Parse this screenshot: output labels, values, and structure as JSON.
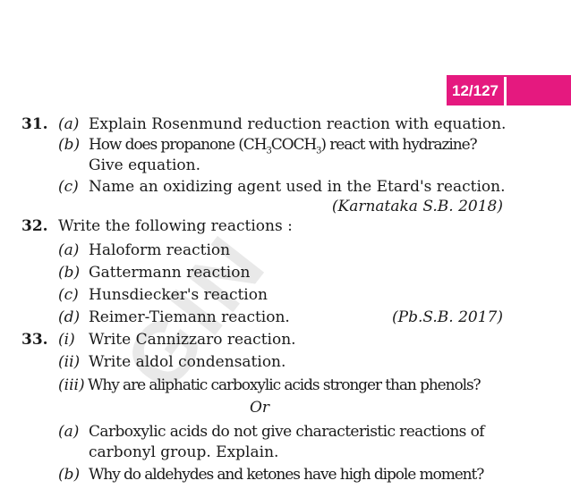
{
  "header": {
    "page_number": "12/127"
  },
  "watermark": "GIN",
  "questions": [
    {
      "number": "31.",
      "parts": [
        {
          "label": "(a)",
          "text": "Explain Rosenmund reduction reaction with equation."
        },
        {
          "label": "(b)",
          "text_before": "How does propanone (CH",
          "sub1": "3",
          "text_mid": "COCH",
          "sub2": "3",
          "text_after": ") react with hydrazine?",
          "cont": "Give equation."
        },
        {
          "label": "(c)",
          "text": "Name an oxidizing agent used in the Etard's reaction."
        }
      ],
      "source": "(Karnataka S.B. 2018)"
    },
    {
      "number": "32.",
      "text": "Write the following reactions :",
      "parts": [
        {
          "label": "(a)",
          "text": "Haloform reaction"
        },
        {
          "label": "(b)",
          "text": "Gattermann reaction"
        },
        {
          "label": "(c)",
          "text": "Hunsdiecker's reaction"
        },
        {
          "label": "(d)",
          "text": "Reimer-Tiemann reaction."
        }
      ],
      "source": "(Pb.S.B. 2017)"
    },
    {
      "number": "33.",
      "parts": [
        {
          "label": "(i)",
          "text": "Write Cannizzaro reaction."
        },
        {
          "label": "(ii)",
          "text": "Write aldol condensation."
        },
        {
          "label": "(iii)",
          "text": "Why are aliphatic carboxylic acids stronger than phenols?"
        }
      ],
      "or": "Or",
      "alt_parts": [
        {
          "label": "(a)",
          "text": "Carboxylic acids do not give characteristic reactions of",
          "cont": "carbonyl group. Explain."
        },
        {
          "label": "(b)",
          "text": "Why do aldehydes and ketones have high dipole moment?"
        }
      ]
    }
  ]
}
